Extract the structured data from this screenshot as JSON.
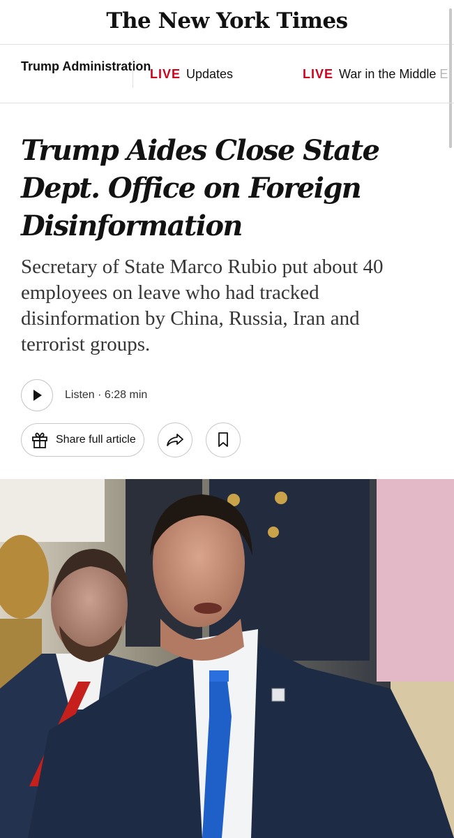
{
  "masthead": {
    "logo": "The New York Times"
  },
  "nav": {
    "section": "Trump Administration",
    "links": [
      {
        "badge": "LIVE",
        "text": "Updates"
      },
      {
        "badge": "LIVE",
        "text": "War in the Middle",
        "faded": "E"
      }
    ]
  },
  "article": {
    "headline": "Trump Aides Close State Dept. Office on Foreign Disinformation",
    "summary": "Secretary of State Marco Rubio put about 40 employees on leave who had tracked disinformation by China, Russia, Iran and terrorist groups.",
    "listen": {
      "text": "Listen · 6:28 min",
      "icon": "play-icon"
    },
    "share": {
      "label": "Share full article",
      "gift_icon": "gift-icon",
      "share_icon": "share-arrow-icon",
      "save_icon": "bookmark-icon"
    }
  },
  "colors": {
    "live_red": "#d0021b",
    "text": "#121212",
    "summary": "#363636",
    "rule": "#dfdfdf"
  }
}
